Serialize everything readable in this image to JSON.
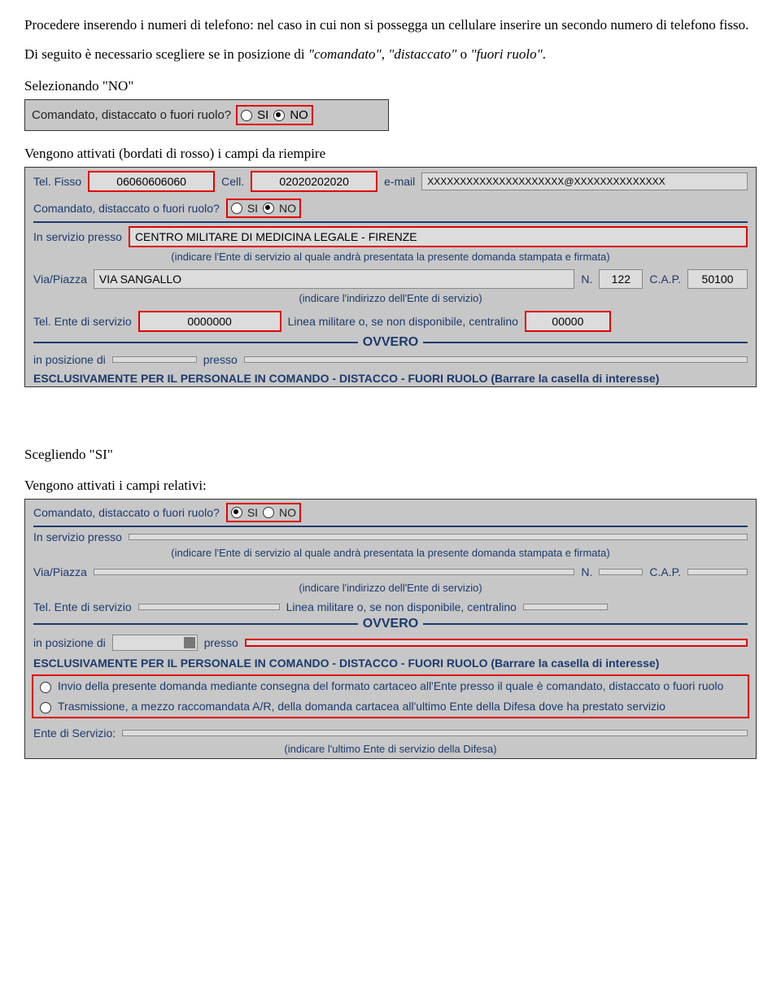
{
  "intro": {
    "p1": "Procedere inserendo i numeri di telefono: nel caso in cui non si possegga un cellulare inserire un secondo numero di telefono fisso.",
    "p2_a": "Di seguito è necessario scegliere se in posizione di ",
    "p2_b": "\"comandato\"",
    "p2_c": ", ",
    "p2_d": "\"distaccato\"",
    "p2_e": " o ",
    "p2_f": "\"fuori ruolo\"",
    "p2_g": "."
  },
  "sec1": {
    "label": "Selezionando \"NO\"",
    "question": "Comandato, distaccato o fuori ruolo?",
    "si": "SI",
    "no": "NO",
    "after": "Vengono attivati (bordati di rosso) i campi da riempire"
  },
  "formA": {
    "tel_fisso_lbl": "Tel. Fisso",
    "tel_fisso_val": "06060606060",
    "cell_lbl": "Cell.",
    "cell_val": "02020202020",
    "email_lbl": "e-mail",
    "email_val": "XXXXXXXXXXXXXXXXXXXXX@XXXXXXXXXXXXXX",
    "question": "Comandato, distaccato o fuori ruolo?",
    "si": "SI",
    "no": "NO",
    "in_servizio_lbl": "In servizio presso",
    "in_servizio_val": "CENTRO MILITARE DI MEDICINA LEGALE - FIRENZE",
    "hint1": "(indicare l'Ente di servizio al quale andrà presentata la presente domanda stampata e firmata)",
    "via_lbl": "Via/Piazza",
    "via_val": "VIA SANGALLO",
    "n_lbl": "N.",
    "n_val": "122",
    "cap_lbl": "C.A.P.",
    "cap_val": "50100",
    "hint2": "(indicare l'indirizzo dell'Ente di servizio)",
    "tel_ente_lbl": "Tel. Ente di servizio",
    "tel_ente_val": "0000000",
    "linea_lbl": "Linea militare o, se non disponibile, centralino",
    "linea_val": "00000",
    "ovvero": "OVVERO",
    "in_pos_lbl": "in posizione di",
    "presso_lbl": "presso",
    "escl": "ESCLUSIVAMENTE PER IL PERSONALE IN COMANDO - DISTACCO - FUORI RUOLO (Barrare la casella di interesse)"
  },
  "sec2": {
    "label": "Scegliendo \"SI\"",
    "after": "Vengono attivati i campi relativi:"
  },
  "formB": {
    "question": "Comandato, distaccato o fuori ruolo?",
    "si": "SI",
    "no": "NO",
    "in_servizio_lbl": "In servizio presso",
    "hint1": "(indicare l'Ente di servizio al quale andrà presentata la presente domanda stampata e firmata)",
    "via_lbl": "Via/Piazza",
    "n_lbl": "N.",
    "cap_lbl": "C.A.P.",
    "hint2": "(indicare l'indirizzo dell'Ente di servizio)",
    "tel_ente_lbl": "Tel. Ente di servizio",
    "linea_lbl": "Linea militare o, se non disponibile, centralino",
    "ovvero": "OVVERO",
    "in_pos_lbl": "in posizione di",
    "presso_lbl": "presso",
    "escl": "ESCLUSIVAMENTE PER IL PERSONALE IN COMANDO - DISTACCO - FUORI RUOLO (Barrare la casella di interesse)",
    "opt1": "Invio della presente domanda mediante consegna del formato cartaceo all'Ente presso il quale è comandato, distaccato o fuori ruolo",
    "opt2": "Trasmissione, a mezzo raccomandata A/R, della domanda cartacea all'ultimo Ente della Difesa dove ha prestato servizio",
    "ente_serv_lbl": "Ente di Servizio:",
    "hint3": "(indicare l'ultimo Ente di servizio della Difesa)"
  }
}
